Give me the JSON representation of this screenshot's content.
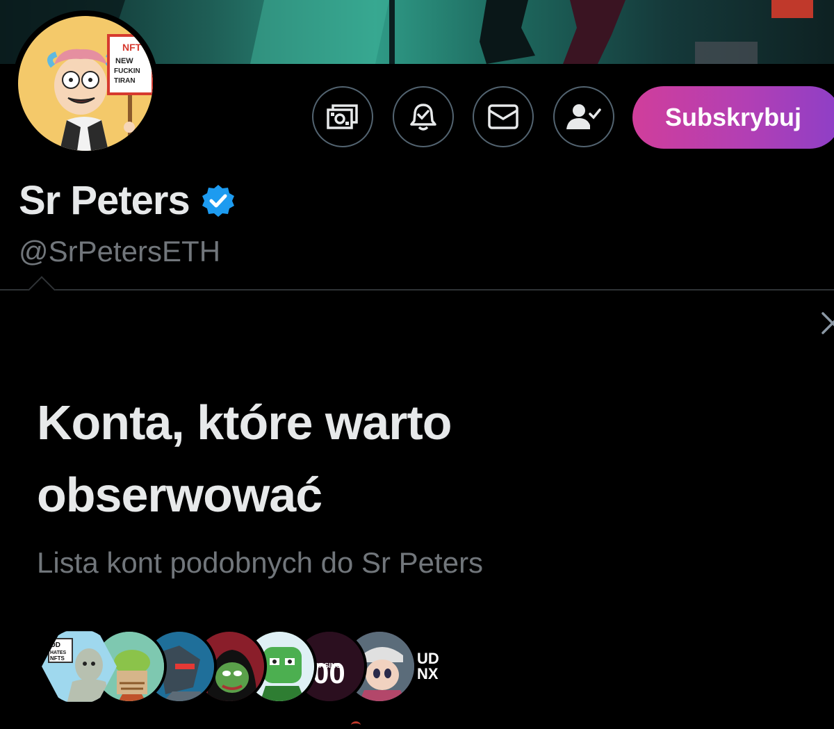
{
  "profile": {
    "display_name": "Sr Peters",
    "handle": "@SrPetersETH",
    "avatar_sign_lines": [
      "NFT",
      "NEW",
      "FUCKIN",
      "TIRAN"
    ]
  },
  "actions": {
    "subscribe_label": "Subskrybuj",
    "tip_icon": "money-icon",
    "notify_icon": "bell-check-icon",
    "message_icon": "envelope-icon",
    "follow_icon": "person-check-icon"
  },
  "suggestions": {
    "title": "Konta, które warto obserwować",
    "subtitle": "Lista kont podobnych do Sr Peters",
    "avatar_texts": {
      "first": [
        "OD",
        "HATES",
        "NFTS"
      ],
      "casino_number": "00",
      "casino_word": "CASINO",
      "last": [
        "UD",
        "NX"
      ]
    }
  },
  "colors": {
    "background": "#000000",
    "text_primary": "#e7e9ea",
    "text_secondary": "#71767b",
    "verified_blue": "#1d9bf0",
    "subscribe_gradient_start": "#d03e9b",
    "subscribe_gradient_end": "#8d3fc7"
  }
}
